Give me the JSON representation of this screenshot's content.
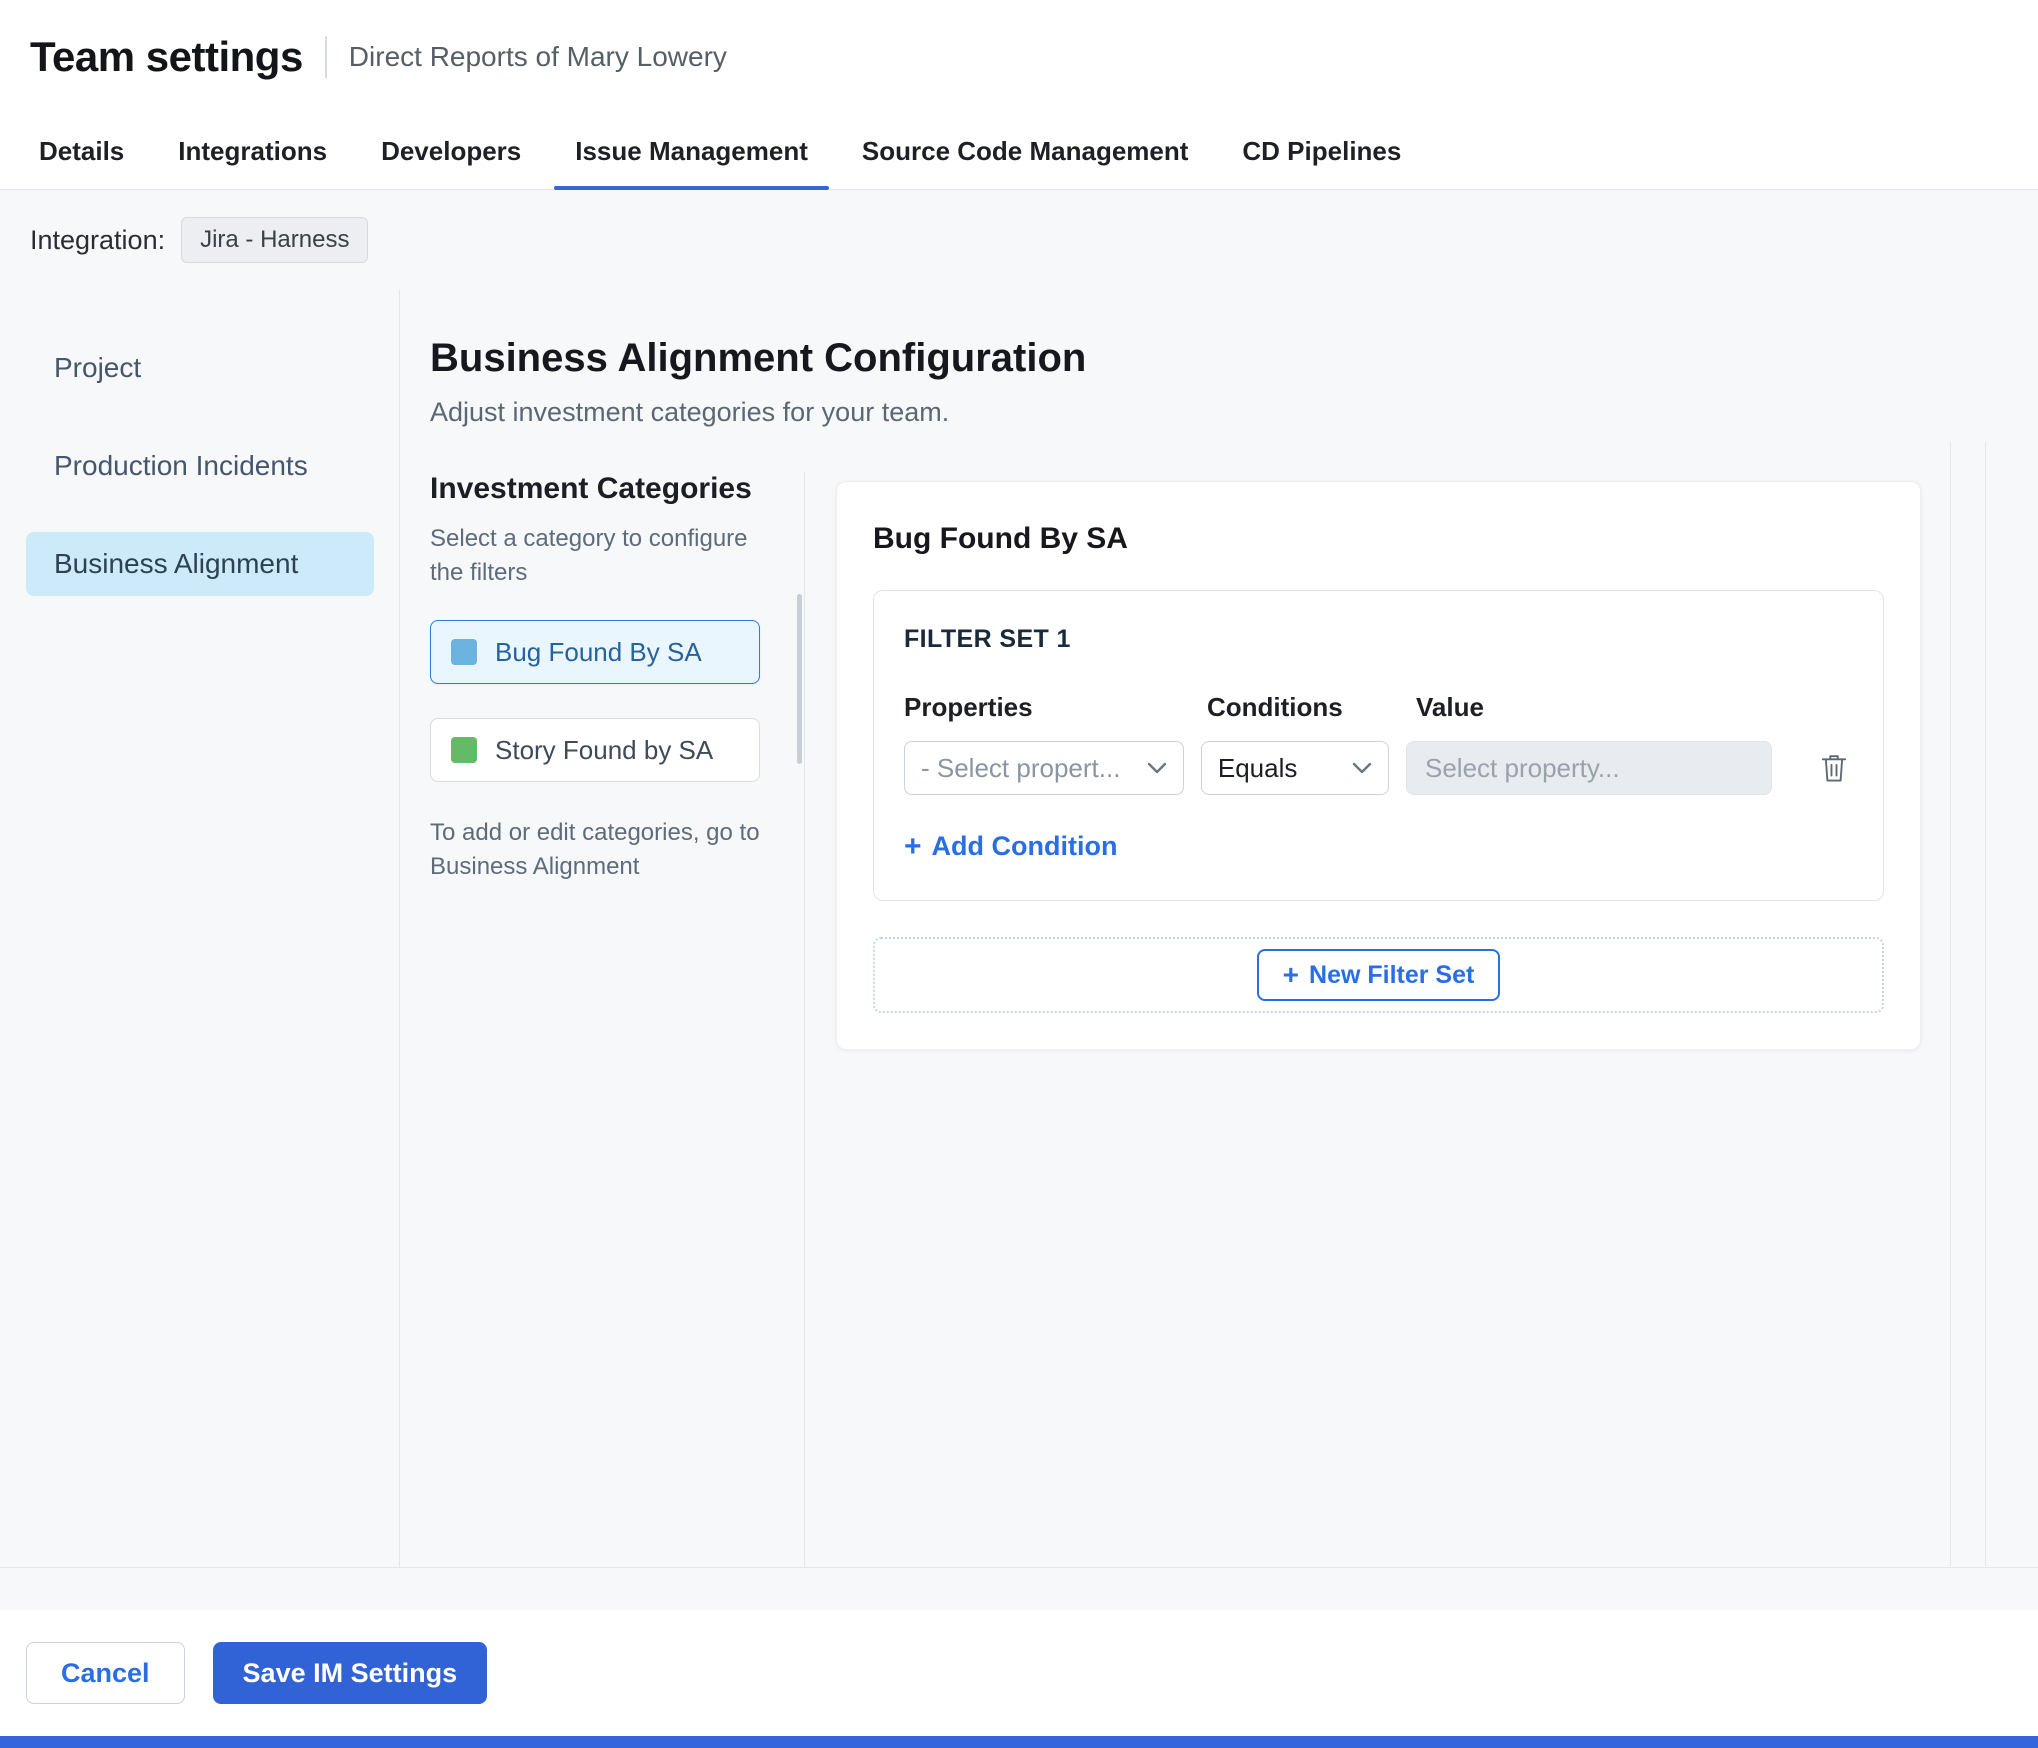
{
  "icons": {
    "plus": "+"
  },
  "colors": {
    "accent": "#2a6ee4",
    "primary_button": "#3263d6",
    "bottom_bar": "#3565dd",
    "tab_underline": "#3467d6"
  },
  "header": {
    "title": "Team settings",
    "subtitle": "Direct Reports of Mary Lowery"
  },
  "tabs": {
    "items": [
      {
        "label": "Details"
      },
      {
        "label": "Integrations"
      },
      {
        "label": "Developers"
      },
      {
        "label": "Issue Management",
        "active": true
      },
      {
        "label": "Source Code Management"
      },
      {
        "label": "CD Pipelines"
      }
    ]
  },
  "integration": {
    "label": "Integration:",
    "chip": "Jira - Harness"
  },
  "sidebar": {
    "items": [
      {
        "label": "Project"
      },
      {
        "label": "Production Incidents"
      },
      {
        "label": "Business Alignment",
        "active": true
      }
    ]
  },
  "main": {
    "title": "Business Alignment Configuration",
    "subtitle": "Adjust investment categories for your team.",
    "categories": {
      "title": "Investment Categories",
      "helper": "Select a category to configure the filters",
      "items": [
        {
          "label": "Bug Found By SA",
          "color": "#6cb3e0",
          "selected": true
        },
        {
          "label": "Story Found by SA",
          "color": "#63bb67",
          "selected": false
        }
      ],
      "footnote": "To add or edit categories, go to Business Alignment"
    },
    "panel": {
      "title": "Bug Found By SA",
      "filter_set": {
        "title": "FILTER SET 1",
        "columns": {
          "properties": "Properties",
          "conditions": "Conditions",
          "value": "Value"
        },
        "property_placeholder": "- Select propert...",
        "condition_value": "Equals",
        "value_placeholder": "Select property...",
        "add_condition_label": "Add Condition"
      },
      "new_filter_set_label": "New Filter Set"
    }
  },
  "footer": {
    "cancel_label": "Cancel",
    "save_label": "Save IM Settings"
  }
}
